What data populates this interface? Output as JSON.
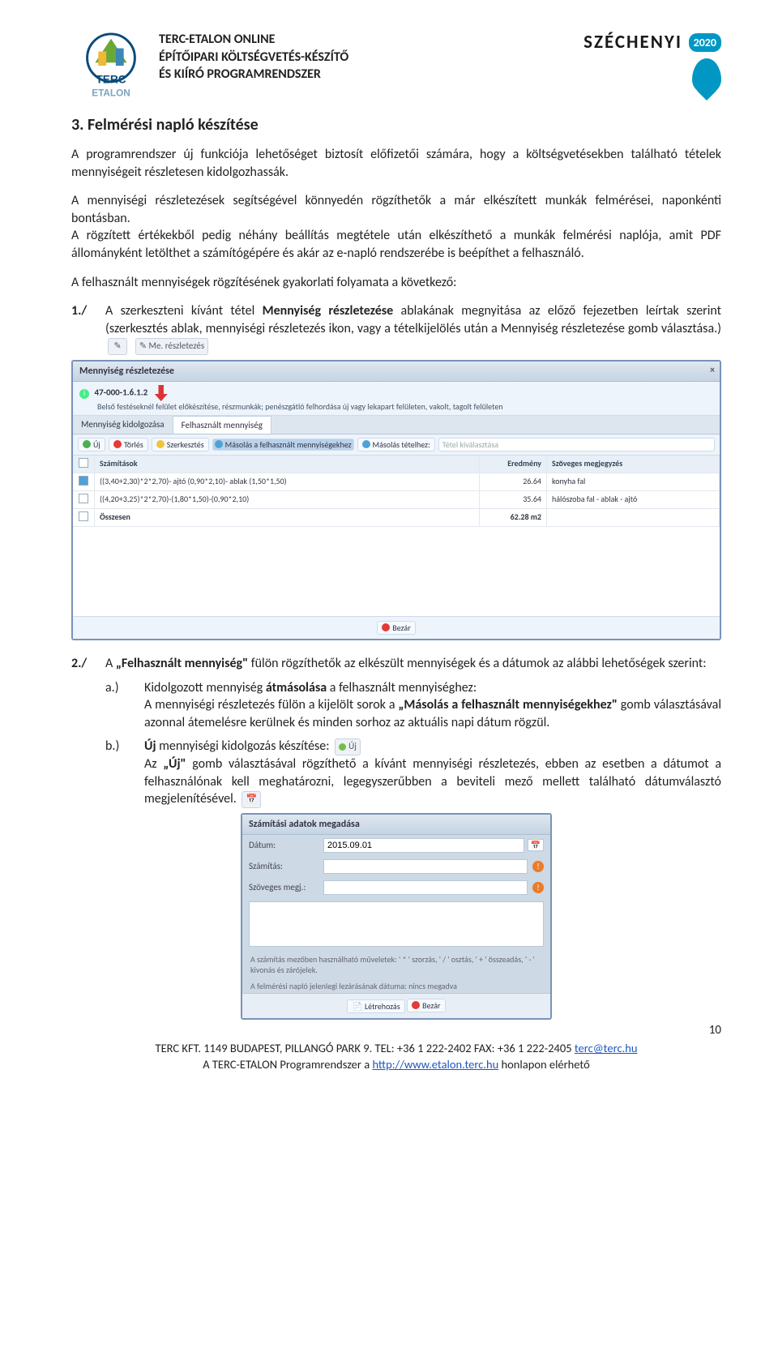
{
  "header": {
    "line1": "TERC-ETALON ONLINE",
    "line2": "ÉPÍTŐIPARI KÖLTSÉGVETÉS-KÉSZÍTŐ",
    "line3": "ÉS KIÍRÓ PROGRAMRENDSZER",
    "szechenyi": "SZÉCHENYI",
    "year": "2020"
  },
  "title": "3. Felmérési napló készítése",
  "para1": "A programrendszer új funkciója lehetőséget biztosít előfizetői számára, hogy a költségvetésekben található tételek mennyiségeit részletesen kidolgozhassák.",
  "para2": "A mennyiségi részletezések segítségével könnyedén rögzíthetők a már elkészített munkák felmérései, naponkénti bontásban.",
  "para3": "A rögzített értékekből pedig néhány beállítás megtétele után elkészíthető a munkák felmérési naplója, amit PDF állományként letölthet a számítógépére és akár az e-napló rendszerébe is beépíthet a felhasználó.",
  "para4": "A felhasznált mennyiségek rögzítésének gyakorlati folyamata a következő:",
  "step1": {
    "num": "1./",
    "text_a": "A szerkeszteni kívánt tétel ",
    "bold1": "Mennyiség részletezése",
    "text_b": " ablakának megnyitása az előző fejezetben leírtak szerint (szerkesztés ablak, mennyiségi részletezés ikon, vagy a tételkijelölés után a Mennyiség részletezése gomb választása.)",
    "chip": "Me. részletezés"
  },
  "shot1": {
    "title": "Mennyiség részletezése",
    "code": "47-000-1.6.1.2",
    "desc": "Belső festéseknél felület előkészítése, részmunkák; penészgátló felhordása új vagy lekapart felületen, vakolt, tagolt felületen",
    "tab1": "Mennyiség kidolgozása",
    "tab2": "Felhasznált mennyiség",
    "uj": "Új",
    "torles": "Törlés",
    "szerk": "Szerkesztés",
    "mas1": "Másolás a felhasznált mennyiségekhez",
    "mas2": "Másolás tételhez:",
    "tsel": "Tétel kiválasztása",
    "h1": "Számítások",
    "h2": "Eredmény",
    "h3": "Szöveges megjegyzés",
    "r1c2": "((3,40+2,30)*2*2,70)- ajtó (0,90*2,10)- ablak (1,50*1,50)",
    "r1c3": "26.64",
    "r1c4": "konyha fal",
    "r2c2": "((4,20+3,25)*2*2,70)-(1,80*1,50)-(0,90*2,10)",
    "r2c3": "35.64",
    "r2c4": "hálószoba fal - ablak - ajtó",
    "sumlbl": "Összesen",
    "sumval": "62.28 m2",
    "close": "Bezár"
  },
  "step2": {
    "num": "2./",
    "text_a": "A ",
    "bold1": "„Felhasznált mennyiség\"",
    "text_b": " fülön rögzíthetők az elkészült mennyiségek és a dátumok az alábbi lehetőségek szerint:"
  },
  "step2a": {
    "lbl": "a.)",
    "t1": "Kidolgozott mennyiség ",
    "b1": "átmásolása",
    "t2": " a felhasznált mennyiséghez:",
    "t3": "A mennyiségi részletezés fülön a kijelölt sorok a ",
    "b2": "„Másolás a felhasznált mennyiségekhez\"",
    "t4": " gomb választásával azonnal átemelésre kerülnek és minden sorhoz az aktuális napi dátum rögzül."
  },
  "step2b": {
    "lbl": "b.)",
    "b1": "Új",
    "t1": " mennyiségi kidolgozás készítése:",
    "chip": "Új",
    "t2": "Az ",
    "b2": "„Új\"",
    "t3": " gomb választásával rögzíthető a kívánt mennyiségi részletezés, ebben az esetben a dátumot a felhasználónak kell meghatározni, legegyszerűbben a beviteli mező mellett található dátumválasztó megjelenítésével."
  },
  "dialog": {
    "title": "Számítási adatok megadása",
    "date_lbl": "Dátum:",
    "date_val": "2015.09.01",
    "calc_lbl": "Számítás:",
    "note_lbl": "Szöveges megj.:",
    "hint1": "A számítás mezőben használható műveletek: ' * ' szorzás, ' / ' osztás, ' + ' összeadás, ' - ' kivonás és zárójelek.",
    "hint2": "A felmérési napló jelenlegi lezárásának dátuma: nincs megadva",
    "create": "Létrehozás",
    "close": "Bezár"
  },
  "pagenum": "10",
  "footer": {
    "l1a": "TERC KFT. 1149 BUDAPEST, PILLANGÓ PARK 9. TEL: +36 1 222-2402 FAX: +36 1 222-2405 ",
    "mail": "terc@terc.hu",
    "l2a": "A TERC-ETALON Programrendszer a ",
    "url": "http://www.etalon.terc.hu",
    "l2b": " honlapon elérhető"
  }
}
